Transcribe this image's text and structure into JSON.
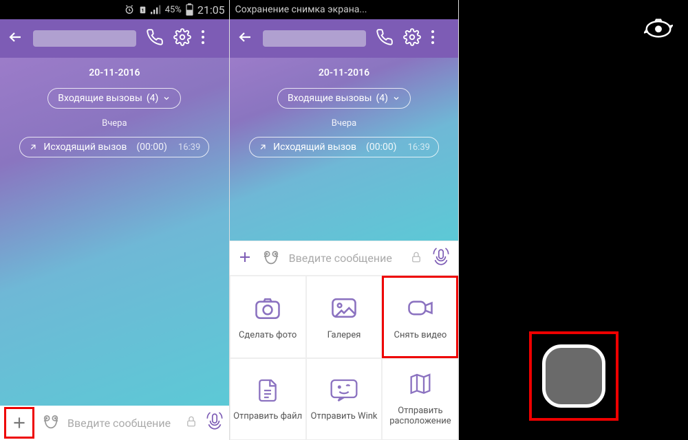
{
  "status": {
    "battery": "45%",
    "time": "21:05",
    "saving_text": "Сохранение снимка экрана..."
  },
  "chat": {
    "date": "20-11-2016",
    "incoming_label": "Входящие вызовы",
    "incoming_count": "(4)",
    "yesterday": "Вчера",
    "outgoing_label": "Исходящий вызов",
    "outgoing_duration": "(00:00)",
    "outgoing_time": "16:39"
  },
  "input": {
    "placeholder": "Введите сообщение",
    "placeholder2": "Введите сообщение"
  },
  "attachments": {
    "photo": "Сделать фото",
    "gallery": "Галерея",
    "video": "Снять видео",
    "file": "Отправить файл",
    "wink": "Отправить Wink",
    "location": "Отправить расположение"
  }
}
